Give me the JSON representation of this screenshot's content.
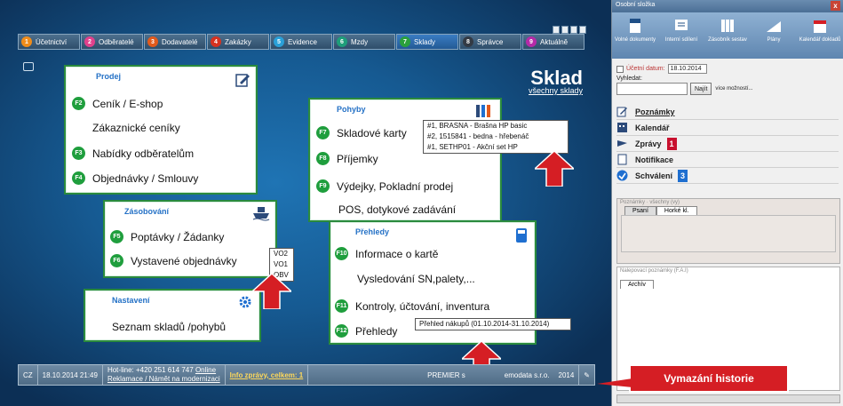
{
  "tabs": [
    {
      "num": "1",
      "label": "Účetnictví",
      "color": "#f08c1a"
    },
    {
      "num": "2",
      "label": "Odběratelé",
      "color": "#e0418c"
    },
    {
      "num": "3",
      "label": "Dodavatelé",
      "color": "#e25a1c"
    },
    {
      "num": "4",
      "label": "Zakázky",
      "color": "#d6321f"
    },
    {
      "num": "5",
      "label": "Evidence",
      "color": "#2aa0d8"
    },
    {
      "num": "6",
      "label": "Mzdy",
      "color": "#1e9e7a"
    },
    {
      "num": "7",
      "label": "Sklady",
      "color": "#2aa03c"
    },
    {
      "num": "8",
      "label": "Správce",
      "color": "#333a44"
    },
    {
      "num": "9",
      "label": "Aktuálně",
      "color": "#b52aa8"
    }
  ],
  "header": {
    "title": "Sklad",
    "subtitle": "všechny sklady"
  },
  "prodej": {
    "title": "Prodej",
    "items": [
      {
        "key": "F2",
        "label": "Ceník / E-shop"
      },
      {
        "key": "",
        "label": "Zákaznické ceníky"
      },
      {
        "key": "F3",
        "label": "Nabídky odběratelům"
      },
      {
        "key": "F4",
        "label": "Objednávky / Smlouvy"
      }
    ]
  },
  "zasobovani": {
    "title": "Zásobování",
    "items": [
      {
        "key": "F5",
        "label": "Poptávky / Žádanky"
      },
      {
        "key": "F6",
        "label": "Vystavené objednávky"
      }
    ],
    "popup": [
      "VO2",
      "VO1",
      "OBV"
    ]
  },
  "nastaveni": {
    "title": "Nastavení",
    "item": "Seznam skladů /pohybů"
  },
  "pohyby": {
    "title": "Pohyby",
    "items": [
      {
        "key": "F7",
        "label": "Skladové karty"
      },
      {
        "key": "F8",
        "label": "Příjemky"
      },
      {
        "key": "F9",
        "label": "Výdejky, Pokladní prodej"
      },
      {
        "key": "",
        "label": "POS, dotykové zadávání"
      }
    ],
    "popup": [
      "#1, BRASNA - Brašna HP basic",
      "#2, 1515841 - bedna - hřebenáč",
      "#1, SETHP01 - Akční set HP"
    ]
  },
  "prehledy": {
    "title": "Přehledy",
    "items": [
      {
        "key": "F10",
        "label": "Informace o kartě"
      },
      {
        "key": "",
        "label": "Vysledování SN,palety,..."
      },
      {
        "key": "F11",
        "label": "Kontroly, účtování, inventura"
      },
      {
        "key": "F12",
        "label": "Přehledy"
      }
    ],
    "popup": "Přehled nákupů (01.10.2014-31.10.2014)"
  },
  "statusbar": {
    "lang": "CZ",
    "datetime": "18.10.2014  21:49",
    "hotline": "Hot-line: +420 251 614 747",
    "online": "Online",
    "reklamace": "Reklamace / Námět na modernizaci",
    "info": "Info zprávy, celkem: 1",
    "company": "PREMIER s",
    "company2": "emodata s.r.o.",
    "year": "2014"
  },
  "side": {
    "header": "Osobní složka",
    "close": "x",
    "tools": [
      {
        "label": "Volné dokumenty"
      },
      {
        "label": "Interní sdílení"
      },
      {
        "label": "Zásobník sestav"
      },
      {
        "label": "Plány"
      },
      {
        "label": "Kalendář dokladů"
      }
    ],
    "ucetni_datum_label": "Účetní datum:",
    "ucetni_datum": "18.10.2014",
    "vyhledat_label": "Vyhledat:",
    "najit": "Najít",
    "vice": "více možností...",
    "links": [
      {
        "label": "Poznámky",
        "count": ""
      },
      {
        "label": "Kalendář",
        "count": ""
      },
      {
        "label": "Zprávy",
        "count": "1"
      },
      {
        "label": "Notifikace",
        "count": ""
      },
      {
        "label": "Schválení",
        "count": "3"
      }
    ],
    "poznamky_label": "Poznámky · všechny (vy)",
    "note_tabs": [
      "Psaní",
      "Horké kl."
    ],
    "nalepovaci": "Nalepovací poznámky (F.A.I)",
    "archiv": "Archív"
  },
  "callout": "Vymazání historie",
  "colors": {
    "panel_border": "#2a8a3d",
    "badge": "#1f9e3d",
    "arrow": "#d51e24",
    "count_red": "#c8102e",
    "count_blue": "#1f6fd0"
  }
}
